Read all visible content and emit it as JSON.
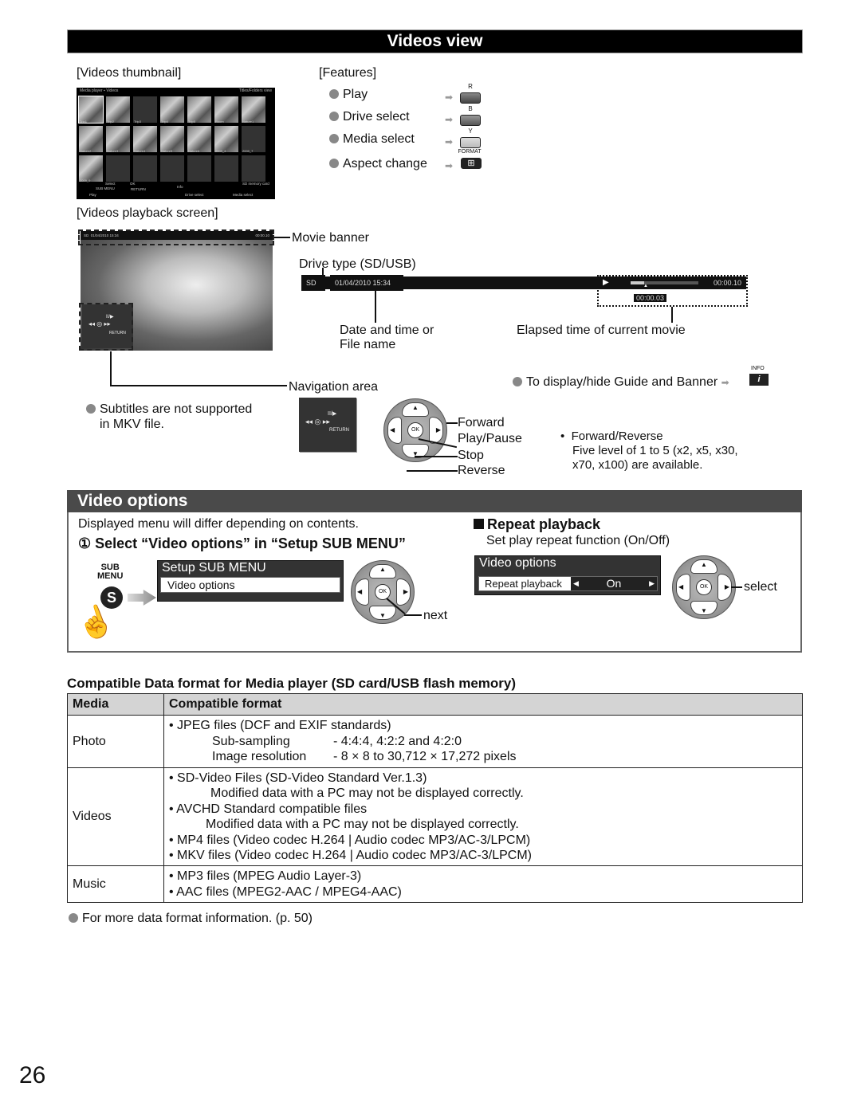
{
  "section_title": "Videos view",
  "thumbnail": {
    "label": "[Videos thumbnail]",
    "screen": {
      "header_left": "Media player",
      "header_mid": "Videos",
      "header_right": "Titles/Folders view",
      "items": [
        "Trip1",
        "Trip2",
        "Trip3",
        "Trip4",
        "Trip5",
        "Room",
        "Nature1",
        "Nature2",
        "Nature3",
        "Nature4",
        "Nature5",
        "Nature6",
        "2009_4",
        "2009_7",
        "2009_9"
      ],
      "footer": {
        "select": "Select",
        "ok": "OK",
        "sub_menu": "SUB MENU",
        "return": "RETURN",
        "info": "Info",
        "drive": "SD memory card",
        "play": "Play",
        "drive_select": "Drive select",
        "media_select": "Media select"
      }
    }
  },
  "features": {
    "label": "[Features]",
    "items": [
      {
        "label": "Play",
        "key": "R"
      },
      {
        "label": "Drive select",
        "key": "B"
      },
      {
        "label": "Media select",
        "key": "Y"
      },
      {
        "label": "Aspect change",
        "key": "FORMAT",
        "glyph": "⊞"
      }
    ]
  },
  "playback": {
    "label": "[Videos playback screen]",
    "mini_banner": {
      "drive": "SD",
      "datetime": "01/04/2010 15:34",
      "time": "00:00.10",
      "elapsed": "00:00.03"
    },
    "nav_return": "RETURN",
    "callouts": {
      "movie_banner": "Movie banner",
      "drive_type": "Drive type (SD/USB)",
      "date_time": "Date and time or",
      "file_name": "File name",
      "elapsed": "Elapsed time of current movie",
      "navigation_area": "Navigation area"
    },
    "banner": {
      "drive": "SD",
      "datetime": "01/04/2010  15:34",
      "play_icon": "▶",
      "total": "00:00.10",
      "elapsed": "00:00.03",
      "progress": 0.2
    }
  },
  "info_note": {
    "text": "To display/hide Guide and Banner",
    "key": "INFO",
    "glyph": "i"
  },
  "subtitles_note": [
    "Subtitles are not supported",
    "in MKV file."
  ],
  "nav_legend": {
    "return": "RETURN",
    "forward": "Forward",
    "play_pause": "Play/Pause",
    "stop": "Stop",
    "reverse": "Reverse",
    "ok": "OK"
  },
  "speed_note": {
    "title": "Forward/Reverse",
    "line1": "Five level of 1 to 5 (x2, x5, x30,",
    "line2": "x70, x100) are available."
  },
  "video_options": {
    "title": "Video options",
    "note": "Displayed menu will differ depending on contents.",
    "step": "① Select “Video options” in “Setup SUB MENU”",
    "sub_menu_key": [
      "SUB",
      "MENU"
    ],
    "s_glyph": "S",
    "setup_menu_title": "Setup SUB MENU",
    "setup_menu_item": "Video options",
    "next_label": "next",
    "repeat": {
      "title": "Repeat playback",
      "desc": "Set play repeat function (On/Off)",
      "menu_title": "Video options",
      "item_label": "Repeat playback",
      "item_value": "On",
      "select_label": "select"
    }
  },
  "format_table": {
    "title": "Compatible Data format for Media player (SD card/USB flash memory)",
    "headers": [
      "Media",
      "Compatible format"
    ],
    "rows": {
      "photo": {
        "media": "Photo",
        "lines": [
          "• JPEG files (DCF and EXIF standards)"
        ],
        "specs": [
          {
            "k": "Sub-sampling",
            "v": "- 4:4:4, 4:2:2 and 4:2:0"
          },
          {
            "k": "Image resolution",
            "v": "- 8 × 8 to 30,712 × 17,272 pixels"
          }
        ]
      },
      "videos": {
        "media": "Videos",
        "lines": [
          "• SD-Video Files (SD-Video Standard Ver.1.3)",
          "Modified data with a PC may not be displayed correctly.",
          "• AVCHD Standard compatible files",
          "Modified data with a PC may not be displayed correctly.",
          "• MP4 files (Video codec H.264 | Audio codec MP3/AC-3/LPCM)",
          "• MKV files (Video codec H.264 | Audio codec MP3/AC-3/LPCM)"
        ]
      },
      "music": {
        "media": "Music",
        "lines": [
          "• MP3 files (MPEG Audio Layer-3)",
          "• AAC files (MPEG2-AAC / MPEG4-AAC)"
        ]
      }
    },
    "footnote": "For more data format information. (p. 50)"
  },
  "page_number": "26"
}
